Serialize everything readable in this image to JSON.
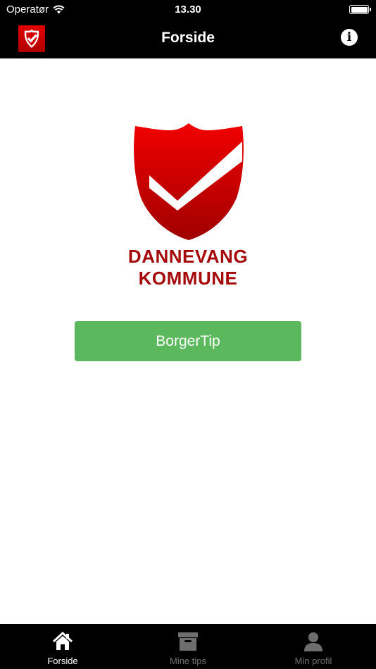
{
  "status_bar": {
    "carrier": "Operatør",
    "time": "13.30"
  },
  "nav": {
    "title": "Forside",
    "logo_icon": "shield-check-icon",
    "info_icon": "info-icon",
    "info_glyph": "i"
  },
  "main": {
    "logo": {
      "icon": "shield-check-icon",
      "line1": "DANNEVANG",
      "line2": "KOMMUNE"
    },
    "button_label": "BorgerTip"
  },
  "tabs": [
    {
      "label": "Forside",
      "icon": "home-icon",
      "active": true
    },
    {
      "label": "Mine tips",
      "icon": "archive-box-icon",
      "active": false
    },
    {
      "label": "Min profil",
      "icon": "user-icon",
      "active": false
    }
  ],
  "colors": {
    "brand_red": "#d10000",
    "brand_dark_red": "#a40a0a",
    "button_green": "#5cb85c",
    "bar_black": "#000000",
    "tab_inactive": "#6e6e6e"
  }
}
